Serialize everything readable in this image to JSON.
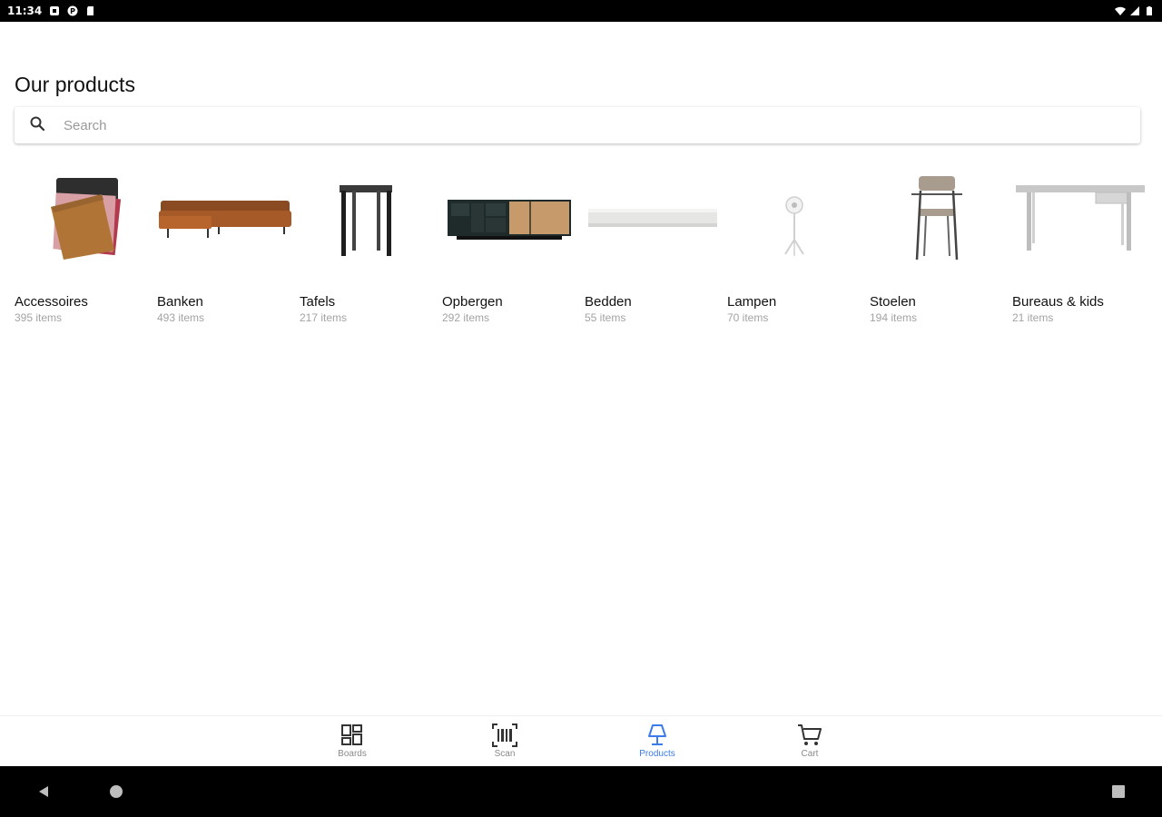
{
  "status_bar": {
    "time": "11:34",
    "left_icons": [
      "notification-icon",
      "app-icon",
      "sdcard-icon"
    ],
    "right_icons": [
      "wifi-icon",
      "signal-icon",
      "battery-icon"
    ]
  },
  "page": {
    "title": "Our products"
  },
  "search": {
    "placeholder": "Search"
  },
  "categories": [
    {
      "name": "Accessoires",
      "count": "395 items"
    },
    {
      "name": "Banken",
      "count": "493 items"
    },
    {
      "name": "Tafels",
      "count": "217 items"
    },
    {
      "name": "Opbergen",
      "count": "292 items"
    },
    {
      "name": "Bedden",
      "count": "55 items"
    },
    {
      "name": "Lampen",
      "count": "70 items"
    },
    {
      "name": "Stoelen",
      "count": "194 items"
    },
    {
      "name": "Bureaus & kids",
      "count": "21 items"
    }
  ],
  "bottom_nav": {
    "items": [
      {
        "label": "Boards",
        "icon": "boards-icon"
      },
      {
        "label": "Scan",
        "icon": "barcode-scan-icon"
      },
      {
        "label": "Products",
        "icon": "lamp-icon",
        "active": true
      },
      {
        "label": "Cart",
        "icon": "cart-icon"
      }
    ],
    "active_color": "#3b7bea"
  },
  "android_nav": {
    "buttons": [
      "back-icon",
      "home-icon",
      "recents-icon"
    ]
  }
}
